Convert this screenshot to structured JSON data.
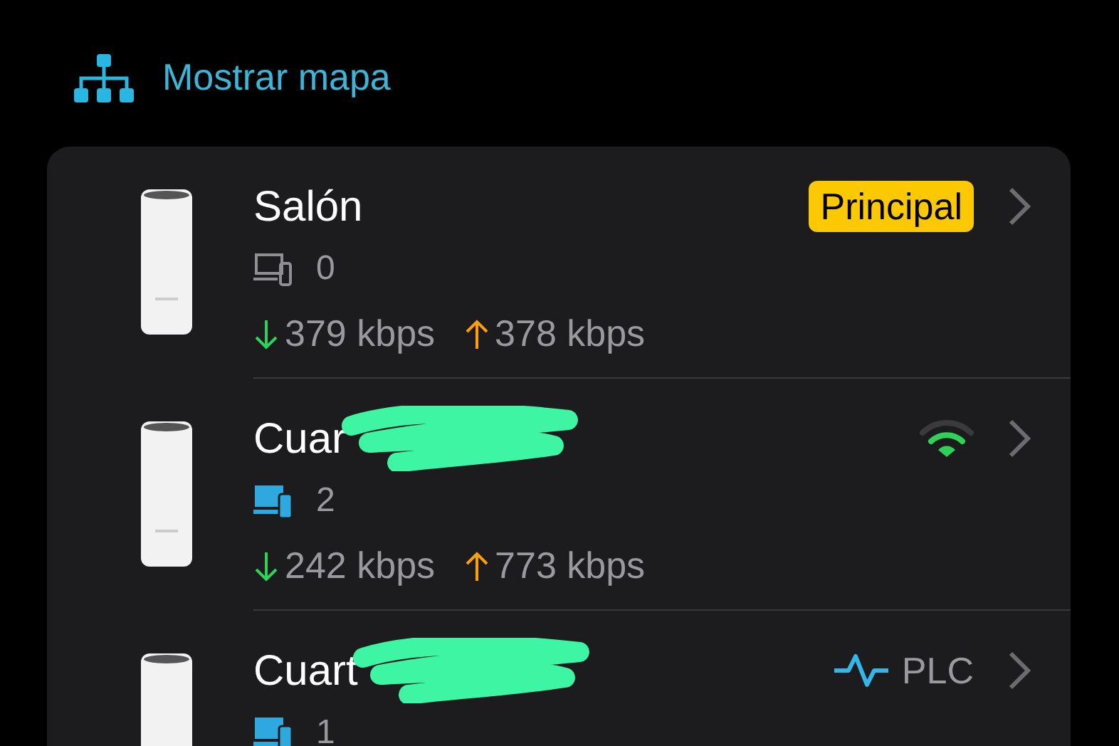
{
  "header": {
    "label": "Mostrar mapa"
  },
  "devices": [
    {
      "name": "Salón",
      "redacted": false,
      "connection": {
        "kind": "primary",
        "label": "Principal"
      },
      "clients_active": false,
      "clients": "0",
      "download": "379 kbps",
      "upload": "378 kbps"
    },
    {
      "name": "Cuar",
      "redacted": true,
      "connection": {
        "kind": "wifi"
      },
      "clients_active": true,
      "clients": "2",
      "download": "242 kbps",
      "upload": "773 kbps"
    },
    {
      "name": "Cuart",
      "redacted": true,
      "connection": {
        "kind": "plc",
        "label": "PLC"
      },
      "clients_active": true,
      "clients": "1"
    }
  ]
}
